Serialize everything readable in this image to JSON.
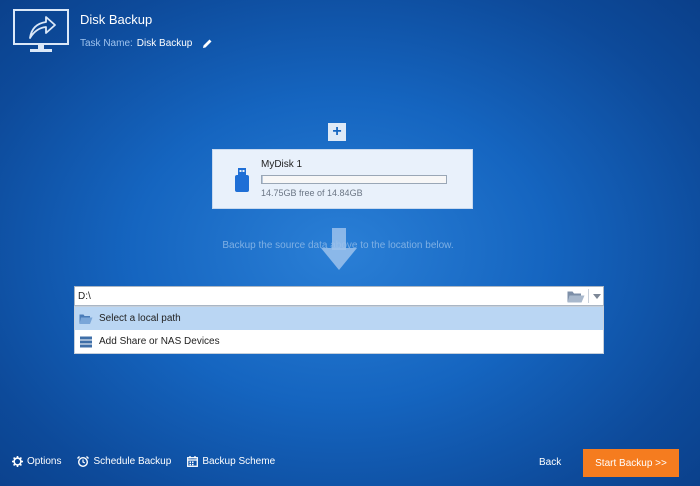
{
  "header": {
    "title": "Disk Backup",
    "task_label": "Task Name:",
    "task_name": "Disk Backup"
  },
  "source": {
    "disk_name": "MyDisk 1",
    "free_text": "14.75GB free of 14.84GB",
    "used_fraction": 0.006
  },
  "hint_text": "Backup the source data above to the location below.",
  "destination": {
    "path_value": "D:\\",
    "options": [
      {
        "label": "Select a local path",
        "icon": "folder-open-icon",
        "selected": true
      },
      {
        "label": "Add Share or NAS Devices",
        "icon": "nas-icon",
        "selected": false
      }
    ]
  },
  "footer": {
    "options_label": "Options",
    "schedule_label": "Schedule Backup",
    "scheme_label": "Backup Scheme",
    "back_label": "Back",
    "start_label": "Start Backup >>"
  },
  "colors": {
    "accent": "#f57c1f",
    "background": "#1565c0",
    "selection": "#bad6f3"
  }
}
